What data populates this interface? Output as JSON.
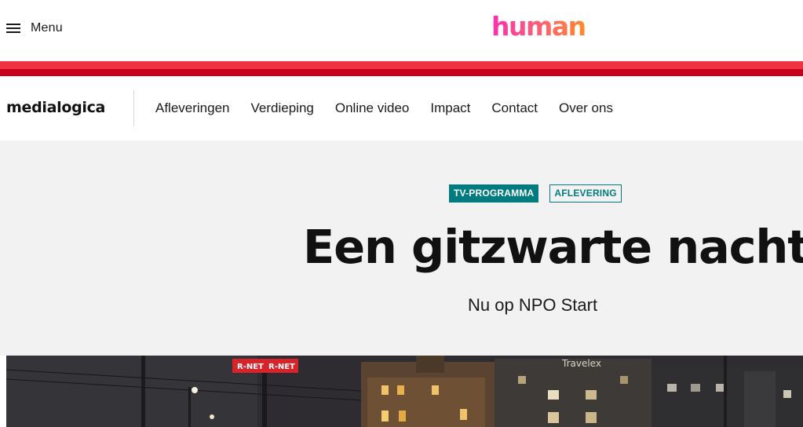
{
  "header": {
    "menu_label": "Menu",
    "brand": "human",
    "brand_colors": [
      "#ff2fb0",
      "#ff8a2a"
    ]
  },
  "stripes": {
    "light": "#ef3340",
    "dark": "#c8001a"
  },
  "program_nav": {
    "logo": "medialogica",
    "items": [
      {
        "label": "Afleveringen"
      },
      {
        "label": "Verdieping"
      },
      {
        "label": "Online video"
      },
      {
        "label": "Impact"
      },
      {
        "label": "Contact"
      },
      {
        "label": "Over ons"
      }
    ]
  },
  "hero": {
    "tags": [
      {
        "label": "TV-PROGRAMMA",
        "style": "solid"
      },
      {
        "label": "AFLEVERING",
        "style": "outline"
      }
    ],
    "title": "Een gitzwarte nacht",
    "subtitle": "Nu op NPO Start",
    "accent": "#007b80"
  },
  "video_still": {
    "signs": [
      "R-NET",
      "R-NET",
      "Travelex"
    ]
  }
}
